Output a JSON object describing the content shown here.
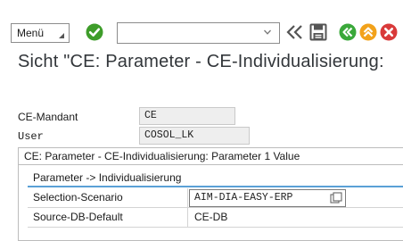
{
  "toolbar": {
    "menu_label": "Menü",
    "command_field_value": "",
    "icons": [
      "ok-check-icon",
      "dropdown-chevron-icon",
      "double-left-arrow-icon",
      "save-icon",
      "back-icon",
      "exit-icon",
      "cancel-icon"
    ],
    "colors": {
      "ok_green": "#3e9d2a",
      "back_green": "#3aa83a",
      "exit_orange": "#f2a21b",
      "cancel_red": "#d93a3a",
      "nav_gray": "#555555"
    }
  },
  "page": {
    "title": "Sicht \"CE: Parameter - CE-Individualisierung:"
  },
  "header_fields": [
    {
      "label": "CE-Mandant",
      "value": "CE"
    },
    {
      "label": "User",
      "value": "COSOL_LK"
    }
  ],
  "group": {
    "title": "CE: Parameter - CE-Individualisierung: Parameter 1 Value",
    "subgroup_title": "Parameter -> Individualisierung",
    "accent": "#5aa0d6",
    "rows": [
      {
        "label": "Selection-Scenario",
        "value": "AIM-DIA-EASY-ERP"
      },
      {
        "label": "Source-DB-Default",
        "value": "CE-DB"
      }
    ]
  }
}
